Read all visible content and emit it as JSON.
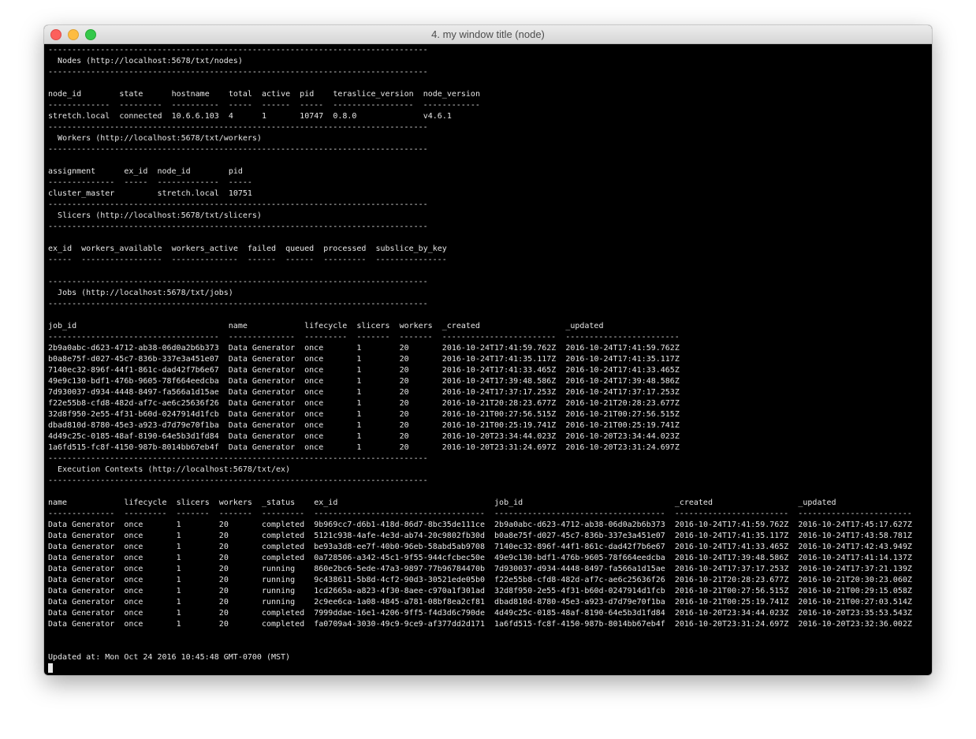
{
  "window": {
    "title": "4. my window title (node)"
  },
  "sections": [
    {
      "title": "Nodes (http://localhost:5678/txt/nodes)",
      "columns": [
        "node_id",
        "state",
        "hostname",
        "total",
        "active",
        "pid",
        "teraslice_version",
        "node_version"
      ],
      "rows": [
        [
          "stretch.local",
          "connected",
          "10.6.6.103",
          "4",
          "1",
          "10747",
          "0.8.0",
          "v4.6.1"
        ]
      ]
    },
    {
      "title": "Workers (http://localhost:5678/txt/workers)",
      "columns": [
        "assignment",
        "ex_id",
        "node_id",
        "pid"
      ],
      "rows": [
        [
          "cluster_master",
          "",
          "stretch.local",
          "10751"
        ]
      ]
    },
    {
      "title": "Slicers (http://localhost:5678/txt/slicers)",
      "columns": [
        "ex_id",
        "workers_available",
        "workers_active",
        "failed",
        "queued",
        "processed",
        "subslice_by_key"
      ],
      "rows": []
    },
    {
      "title": "Jobs (http://localhost:5678/txt/jobs)",
      "columns": [
        "job_id",
        "name",
        "lifecycle",
        "slicers",
        "workers",
        "_created",
        "_updated"
      ],
      "rows": [
        [
          "2b9a0abc-d623-4712-ab38-06d0a2b6b373",
          "Data Generator",
          "once",
          "1",
          "20",
          "2016-10-24T17:41:59.762Z",
          "2016-10-24T17:41:59.762Z"
        ],
        [
          "b0a8e75f-d027-45c7-836b-337e3a451e07",
          "Data Generator",
          "once",
          "1",
          "20",
          "2016-10-24T17:41:35.117Z",
          "2016-10-24T17:41:35.117Z"
        ],
        [
          "7140ec32-896f-44f1-861c-dad42f7b6e67",
          "Data Generator",
          "once",
          "1",
          "20",
          "2016-10-24T17:41:33.465Z",
          "2016-10-24T17:41:33.465Z"
        ],
        [
          "49e9c130-bdf1-476b-9605-78f664eedcba",
          "Data Generator",
          "once",
          "1",
          "20",
          "2016-10-24T17:39:48.586Z",
          "2016-10-24T17:39:48.586Z"
        ],
        [
          "7d930037-d934-4448-8497-fa566a1d15ae",
          "Data Generator",
          "once",
          "1",
          "20",
          "2016-10-24T17:37:17.253Z",
          "2016-10-24T17:37:17.253Z"
        ],
        [
          "f22e55b8-cfd8-482d-af7c-ae6c25636f26",
          "Data Generator",
          "once",
          "1",
          "20",
          "2016-10-21T20:28:23.677Z",
          "2016-10-21T20:28:23.677Z"
        ],
        [
          "32d8f950-2e55-4f31-b60d-0247914d1fcb",
          "Data Generator",
          "once",
          "1",
          "20",
          "2016-10-21T00:27:56.515Z",
          "2016-10-21T00:27:56.515Z"
        ],
        [
          "dbad810d-8780-45e3-a923-d7d79e70f1ba",
          "Data Generator",
          "once",
          "1",
          "20",
          "2016-10-21T00:25:19.741Z",
          "2016-10-21T00:25:19.741Z"
        ],
        [
          "4d49c25c-0185-48af-8190-64e5b3d1fd84",
          "Data Generator",
          "once",
          "1",
          "20",
          "2016-10-20T23:34:44.023Z",
          "2016-10-20T23:34:44.023Z"
        ],
        [
          "1a6fd515-fc8f-4150-987b-8014bb67eb4f",
          "Data Generator",
          "once",
          "1",
          "20",
          "2016-10-20T23:31:24.697Z",
          "2016-10-20T23:31:24.697Z"
        ]
      ]
    },
    {
      "title": "Execution Contexts (http://localhost:5678/txt/ex)",
      "columns": [
        "name",
        "lifecycle",
        "slicers",
        "workers",
        "_status",
        "ex_id",
        "job_id",
        "_created",
        "_updated"
      ],
      "rows": [
        [
          "Data Generator",
          "once",
          "1",
          "20",
          "completed",
          "9b969cc7-d6b1-418d-86d7-8bc35de111ce",
          "2b9a0abc-d623-4712-ab38-06d0a2b6b373",
          "2016-10-24T17:41:59.762Z",
          "2016-10-24T17:45:17.627Z"
        ],
        [
          "Data Generator",
          "once",
          "1",
          "20",
          "completed",
          "5121c938-4afe-4e3d-ab74-20c9802fb30d",
          "b0a8e75f-d027-45c7-836b-337e3a451e07",
          "2016-10-24T17:41:35.117Z",
          "2016-10-24T17:43:58.781Z"
        ],
        [
          "Data Generator",
          "once",
          "1",
          "20",
          "completed",
          "be93a3d8-ee7f-40b0-96eb-58abd5ab9708",
          "7140ec32-896f-44f1-861c-dad42f7b6e67",
          "2016-10-24T17:41:33.465Z",
          "2016-10-24T17:42:43.949Z"
        ],
        [
          "Data Generator",
          "once",
          "1",
          "20",
          "completed",
          "0a728506-a342-45c1-9f55-944cfcbec50e",
          "49e9c130-bdf1-476b-9605-78f664eedcba",
          "2016-10-24T17:39:48.586Z",
          "2016-10-24T17:41:14.137Z"
        ],
        [
          "Data Generator",
          "once",
          "1",
          "20",
          "running",
          "860e2bc6-5ede-47a3-9897-77b96784470b",
          "7d930037-d934-4448-8497-fa566a1d15ae",
          "2016-10-24T17:37:17.253Z",
          "2016-10-24T17:37:21.139Z"
        ],
        [
          "Data Generator",
          "once",
          "1",
          "20",
          "running",
          "9c438611-5b8d-4cf2-90d3-30521ede05b0",
          "f22e55b8-cfd8-482d-af7c-ae6c25636f26",
          "2016-10-21T20:28:23.677Z",
          "2016-10-21T20:30:23.060Z"
        ],
        [
          "Data Generator",
          "once",
          "1",
          "20",
          "running",
          "1cd2665a-a823-4f30-8aee-c970a1f301ad",
          "32d8f950-2e55-4f31-b60d-0247914d1fcb",
          "2016-10-21T00:27:56.515Z",
          "2016-10-21T00:29:15.058Z"
        ],
        [
          "Data Generator",
          "once",
          "1",
          "20",
          "running",
          "2c9ee6ca-1a08-4845-a781-08bf8ea2cf81",
          "dbad810d-8780-45e3-a923-d7d79e70f1ba",
          "2016-10-21T00:25:19.741Z",
          "2016-10-21T00:27:03.514Z"
        ],
        [
          "Data Generator",
          "once",
          "1",
          "20",
          "completed",
          "7999ddae-16e1-4206-9ff5-f4d3d6c790de",
          "4d49c25c-0185-48af-8190-64e5b3d1fd84",
          "2016-10-20T23:34:44.023Z",
          "2016-10-20T23:35:53.543Z"
        ],
        [
          "Data Generator",
          "once",
          "1",
          "20",
          "completed",
          "fa0709a4-3030-49c9-9ce9-af377dd2d171",
          "1a6fd515-fc8f-4150-987b-8014bb67eb4f",
          "2016-10-20T23:31:24.697Z",
          "2016-10-20T23:32:36.002Z"
        ]
      ]
    }
  ],
  "footer": {
    "updated_at": "Updated at: Mon Oct 24 2016 10:45:48 GMT-0700 (MST)"
  }
}
